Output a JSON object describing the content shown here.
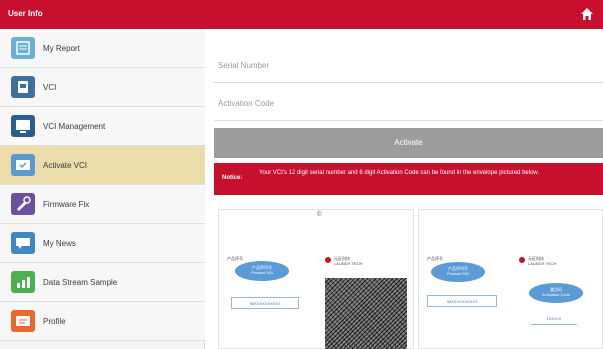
{
  "titlebar": {
    "title": "User Info"
  },
  "sidebar": {
    "items": [
      {
        "label": "My Report",
        "icon": "report-icon",
        "color": "#6aaed6"
      },
      {
        "label": "VCI",
        "icon": "vci-icon",
        "color": "#3d6fa3"
      },
      {
        "label": "VCI Management",
        "icon": "vci-management-icon",
        "color": "#2b5d94"
      },
      {
        "label": "Activate VCI",
        "icon": "activate-icon",
        "color": "#5a9ad0"
      },
      {
        "label": "Firmware Fix",
        "icon": "firmware-fix-icon",
        "color": "#6b4fa0"
      },
      {
        "label": "My News",
        "icon": "news-icon",
        "color": "#3f88c5"
      },
      {
        "label": "Data Stream Sample",
        "icon": "data-stream-icon",
        "color": "#4caf50"
      },
      {
        "label": "Profile",
        "icon": "profile-icon",
        "color": "#e8692a"
      }
    ],
    "active_index": 3,
    "active_color": "#ecdcab"
  },
  "form": {
    "serial_placeholder": "Serial Number",
    "activation_placeholder": "Activation Code",
    "activate_label": "Activate"
  },
  "notice": {
    "label": "Notice:",
    "text": "Your VCI's 12 digit serial number and 6 digit Activation Code can be found in the envelope pictured below."
  },
  "example": {
    "card1_mark": "©",
    "card1_tag": "产品序号",
    "card1_bubble": "产品序列号\nProduct S/N",
    "card1_number": "98XXXXXXXXX1",
    "card1_brand": "元征科技",
    "card1_brand_en": "LAUNCH TECH",
    "card2_tag": "产品序号",
    "card2_bubble": "产品序列号\nProduct S/N",
    "card2_number": "98XXXXXXXXX1",
    "card2_brand": "元征科技",
    "card2_brand_en": "LAUNCH TECH",
    "card2_code_bubble": "激活码\nActivation Code",
    "card2_code": "123XXX"
  },
  "colors": {
    "brand": "#c8102e",
    "button_disabled": "#9d9d9d"
  }
}
